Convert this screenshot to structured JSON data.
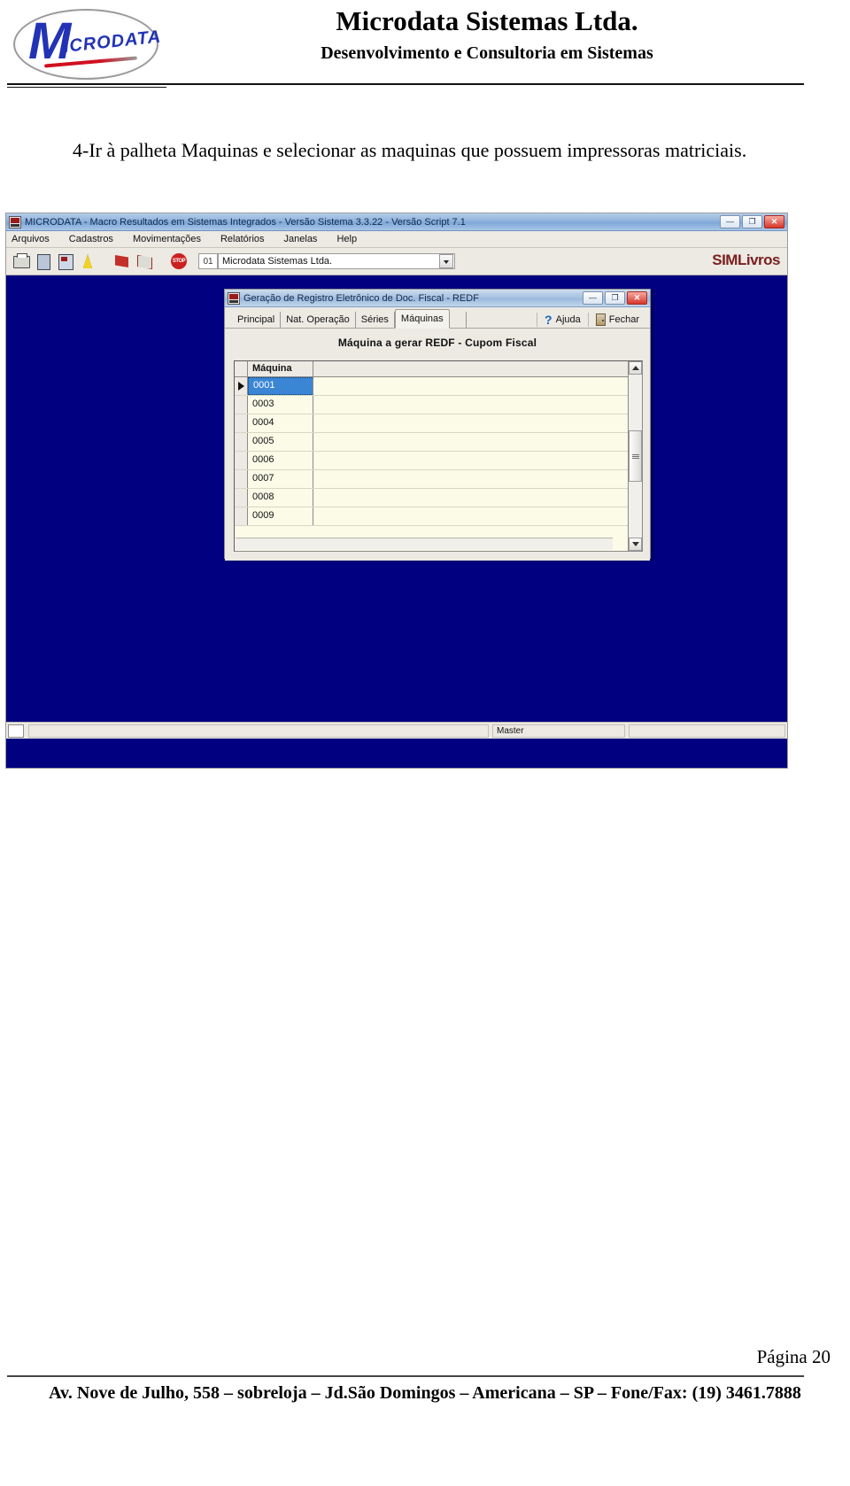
{
  "document": {
    "header": {
      "company_title": "Microdata Sistemas Ltda.",
      "company_subtitle": "Desenvolvimento e Consultoria em Sistemas",
      "logo_letter": "M",
      "logo_word": "ICRODATA"
    },
    "paragraph": "4-Ir à palheta Maquinas e selecionar as maquinas que possuem impressoras matriciais.",
    "footer": {
      "page_label": "Página 20",
      "address": "Av. Nove de Julho, 558 – sobreloja – Jd.São Domingos – Americana – SP – Fone/Fax: (19) 3461.7888"
    }
  },
  "app_window": {
    "title": "MICRODATA - Macro Resultados em Sistemas Integrados - Versão Sistema 3.3.22 - Versão Script 7.1",
    "window_buttons": {
      "minimize": "—",
      "restore": "❐",
      "close": "✕"
    },
    "menu": [
      {
        "label": "Arquivos",
        "accel": "A"
      },
      {
        "label": "Cadastros",
        "accel": "C"
      },
      {
        "label": "Movimentações",
        "accel": "M"
      },
      {
        "label": "Relatórios",
        "accel": "R"
      },
      {
        "label": "Janelas",
        "accel": "J"
      },
      {
        "label": "Help",
        "accel": "H"
      }
    ],
    "toolbar": {
      "icons": [
        "printer-icon",
        "document-icon",
        "report-icon",
        "lightning-icon",
        "import-flag-icon",
        "export-flag-icon",
        "stop-icon"
      ],
      "stop_label": "STOP",
      "company_code": "01",
      "company_combo_value": "Microdata Sistemas Ltda."
    },
    "brand": "SIMLivros",
    "statusbar": {
      "left": "",
      "mid": "",
      "master": "Master"
    }
  },
  "dialog": {
    "title": "Geração de Registro Eletrônico de Doc. Fiscal - REDF",
    "window_buttons": {
      "minimize": "—",
      "restore": "❐",
      "close": "✕"
    },
    "tabs": [
      {
        "label": "Principal",
        "active": false
      },
      {
        "label": "Nat. Operação",
        "active": false
      },
      {
        "label": "Séries",
        "active": false
      },
      {
        "label": "Máquinas",
        "active": true
      }
    ],
    "actions": [
      {
        "label": "Ajuda",
        "accel": "A",
        "icon": "question-mark-icon"
      },
      {
        "label": "Fechar",
        "accel": "F",
        "icon": "exit-door-icon"
      }
    ],
    "heading": "Máquina a gerar REDF  -  Cupom Fiscal",
    "grid": {
      "columns": [
        "Máquina"
      ],
      "rows": [
        {
          "maquina": "0001",
          "selected": true
        },
        {
          "maquina": "0003",
          "selected": false
        },
        {
          "maquina": "0004",
          "selected": false
        },
        {
          "maquina": "0005",
          "selected": false
        },
        {
          "maquina": "0006",
          "selected": false
        },
        {
          "maquina": "0007",
          "selected": false
        },
        {
          "maquina": "0008",
          "selected": false
        },
        {
          "maquina": "0009",
          "selected": false
        }
      ]
    }
  },
  "colors": {
    "mdi_desktop": "#000080",
    "selection_blue": "#3a86d4",
    "grid_background": "#fbfbe8",
    "brand_red": "#7a2020",
    "logo_blue": "#2233b5"
  }
}
